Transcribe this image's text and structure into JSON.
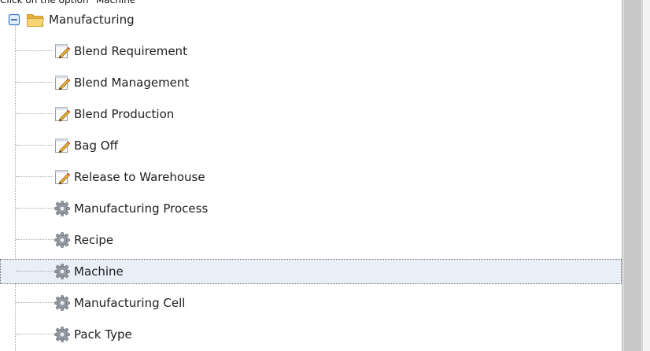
{
  "instruction": "Click on the option \"Machine\"",
  "tree": {
    "root": {
      "label": "Manufacturing",
      "icon": "folder-open-icon",
      "expander": "minus-icon"
    },
    "items": [
      {
        "label": "Blend Requirement",
        "icon": "edit-document-icon"
      },
      {
        "label": "Blend Management",
        "icon": "edit-document-icon"
      },
      {
        "label": "Blend Production",
        "icon": "edit-document-icon"
      },
      {
        "label": "Bag Off",
        "icon": "edit-document-icon"
      },
      {
        "label": "Release to Warehouse",
        "icon": "edit-document-icon"
      },
      {
        "label": "Manufacturing Process",
        "icon": "gear-icon"
      },
      {
        "label": "Recipe",
        "icon": "gear-icon"
      },
      {
        "label": "Machine",
        "icon": "gear-icon",
        "selected": true
      },
      {
        "label": "Manufacturing Cell",
        "icon": "gear-icon"
      },
      {
        "label": "Pack Type",
        "icon": "gear-icon"
      }
    ]
  },
  "colors": {
    "selected_bg": "#e9eef7",
    "expander": "#3c78c8",
    "folder": "#f2c24f"
  }
}
